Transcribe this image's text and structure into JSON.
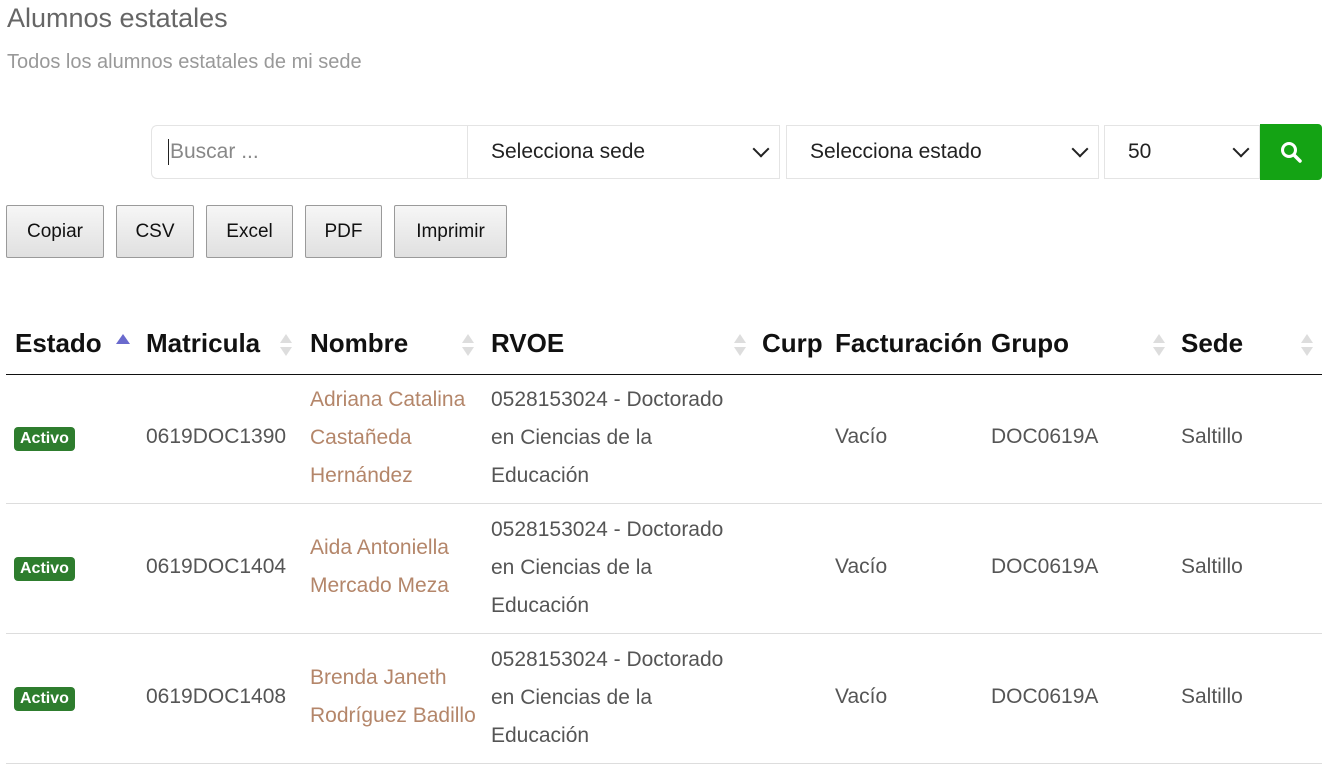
{
  "page": {
    "title": "Alumnos estatales",
    "subtitle": "Todos los alumnos estatales de mi sede"
  },
  "filters": {
    "search_placeholder": "Buscar ...",
    "sede_select": "Selecciona sede",
    "estado_select": "Selecciona estado",
    "page_size": "50",
    "search_icon": "search-icon",
    "accent": "#14a314"
  },
  "export_buttons": [
    "Copiar",
    "CSV",
    "Excel",
    "PDF",
    "Imprimir"
  ],
  "table": {
    "columns": [
      "Estado",
      "Matricula",
      "Nombre",
      "RVOE",
      "Curp",
      "Facturación",
      "Grupo",
      "Sede"
    ],
    "sorted_column": "Estado",
    "sort_direction": "asc",
    "rows": [
      {
        "estado": "Activo",
        "matricula": "0619DOC1390",
        "nombre_lines": [
          "Adriana Catalina",
          "Castañeda",
          "Hernández"
        ],
        "rvoe_lines": [
          "0528153024 - Doctorado",
          "en Ciencias de la",
          "Educación"
        ],
        "curp": "",
        "facturacion": "Vacío",
        "grupo": "DOC0619A",
        "sede": "Saltillo"
      },
      {
        "estado": "Activo",
        "matricula": "0619DOC1404",
        "nombre_lines": [
          "Aida Antoniella",
          "Mercado Meza"
        ],
        "rvoe_lines": [
          "0528153024 - Doctorado",
          "en Ciencias de la",
          "Educación"
        ],
        "curp": "",
        "facturacion": "Vacío",
        "grupo": "DOC0619A",
        "sede": "Saltillo"
      },
      {
        "estado": "Activo",
        "matricula": "0619DOC1408",
        "nombre_lines": [
          "Brenda Janeth",
          "Rodríguez Badillo"
        ],
        "rvoe_lines": [
          "0528153024 - Doctorado",
          "en Ciencias de la",
          "Educación"
        ],
        "curp": "",
        "facturacion": "Vacío",
        "grupo": "DOC0619A",
        "sede": "Saltillo"
      }
    ]
  },
  "colors": {
    "status_active": "#2e7d2e",
    "name_link": "#b4866a",
    "sort_active": "#6a6acd"
  }
}
